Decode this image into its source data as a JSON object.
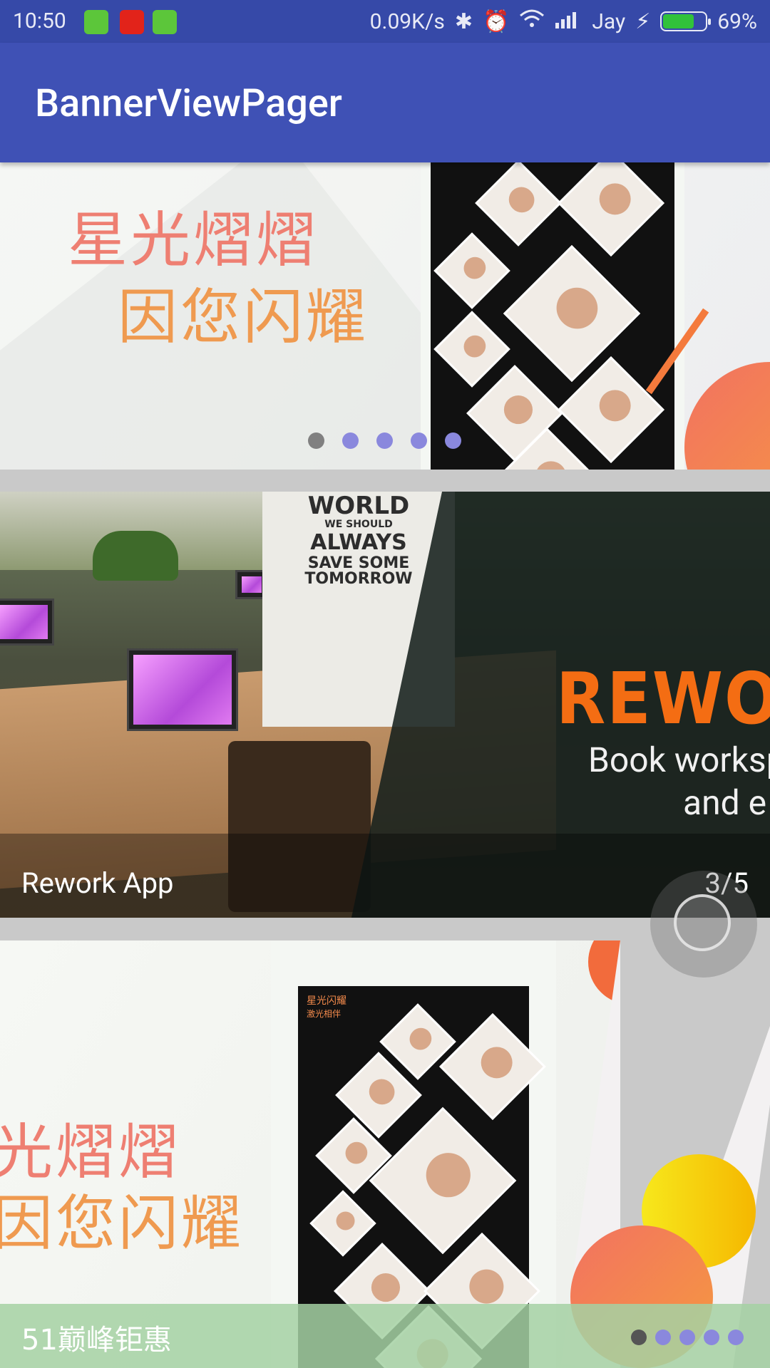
{
  "status_bar": {
    "time": "10:50",
    "net_speed": "0.09K/s",
    "carrier": "Jay",
    "battery": "69%",
    "battery_level": 0.69
  },
  "app_bar": {
    "title": "BannerViewPager"
  },
  "banner1": {
    "slogan_line1": "星光熠熠",
    "slogan_line2": "因您闪耀",
    "indicator_count": 5,
    "indicator_active": 0
  },
  "banner2": {
    "poster_world": "WORLD",
    "poster_line1": "WE SHOULD",
    "poster_line2": "ALWAYS",
    "poster_line3": "SAVE SOME",
    "poster_line4": "TOMORROW",
    "brand": "REWOR",
    "tagline1": "Book worksp",
    "tagline2": "and e",
    "caption": "Rework App",
    "counter": "3/5"
  },
  "banner3": {
    "slogan_line1": "光熠熠",
    "slogan_line2": "因您闪耀",
    "phone_header1": "星光闪耀",
    "phone_header2": "激光相伴",
    "caption": "51巅峰钜惠",
    "indicator_count": 5,
    "indicator_active": 0
  },
  "colors": {
    "primary": "#3f51b5",
    "status_bar": "#3649a8",
    "indicator_active": "#808080",
    "indicator_inactive": "#8a88dd",
    "brand_orange": "#f46d13"
  }
}
